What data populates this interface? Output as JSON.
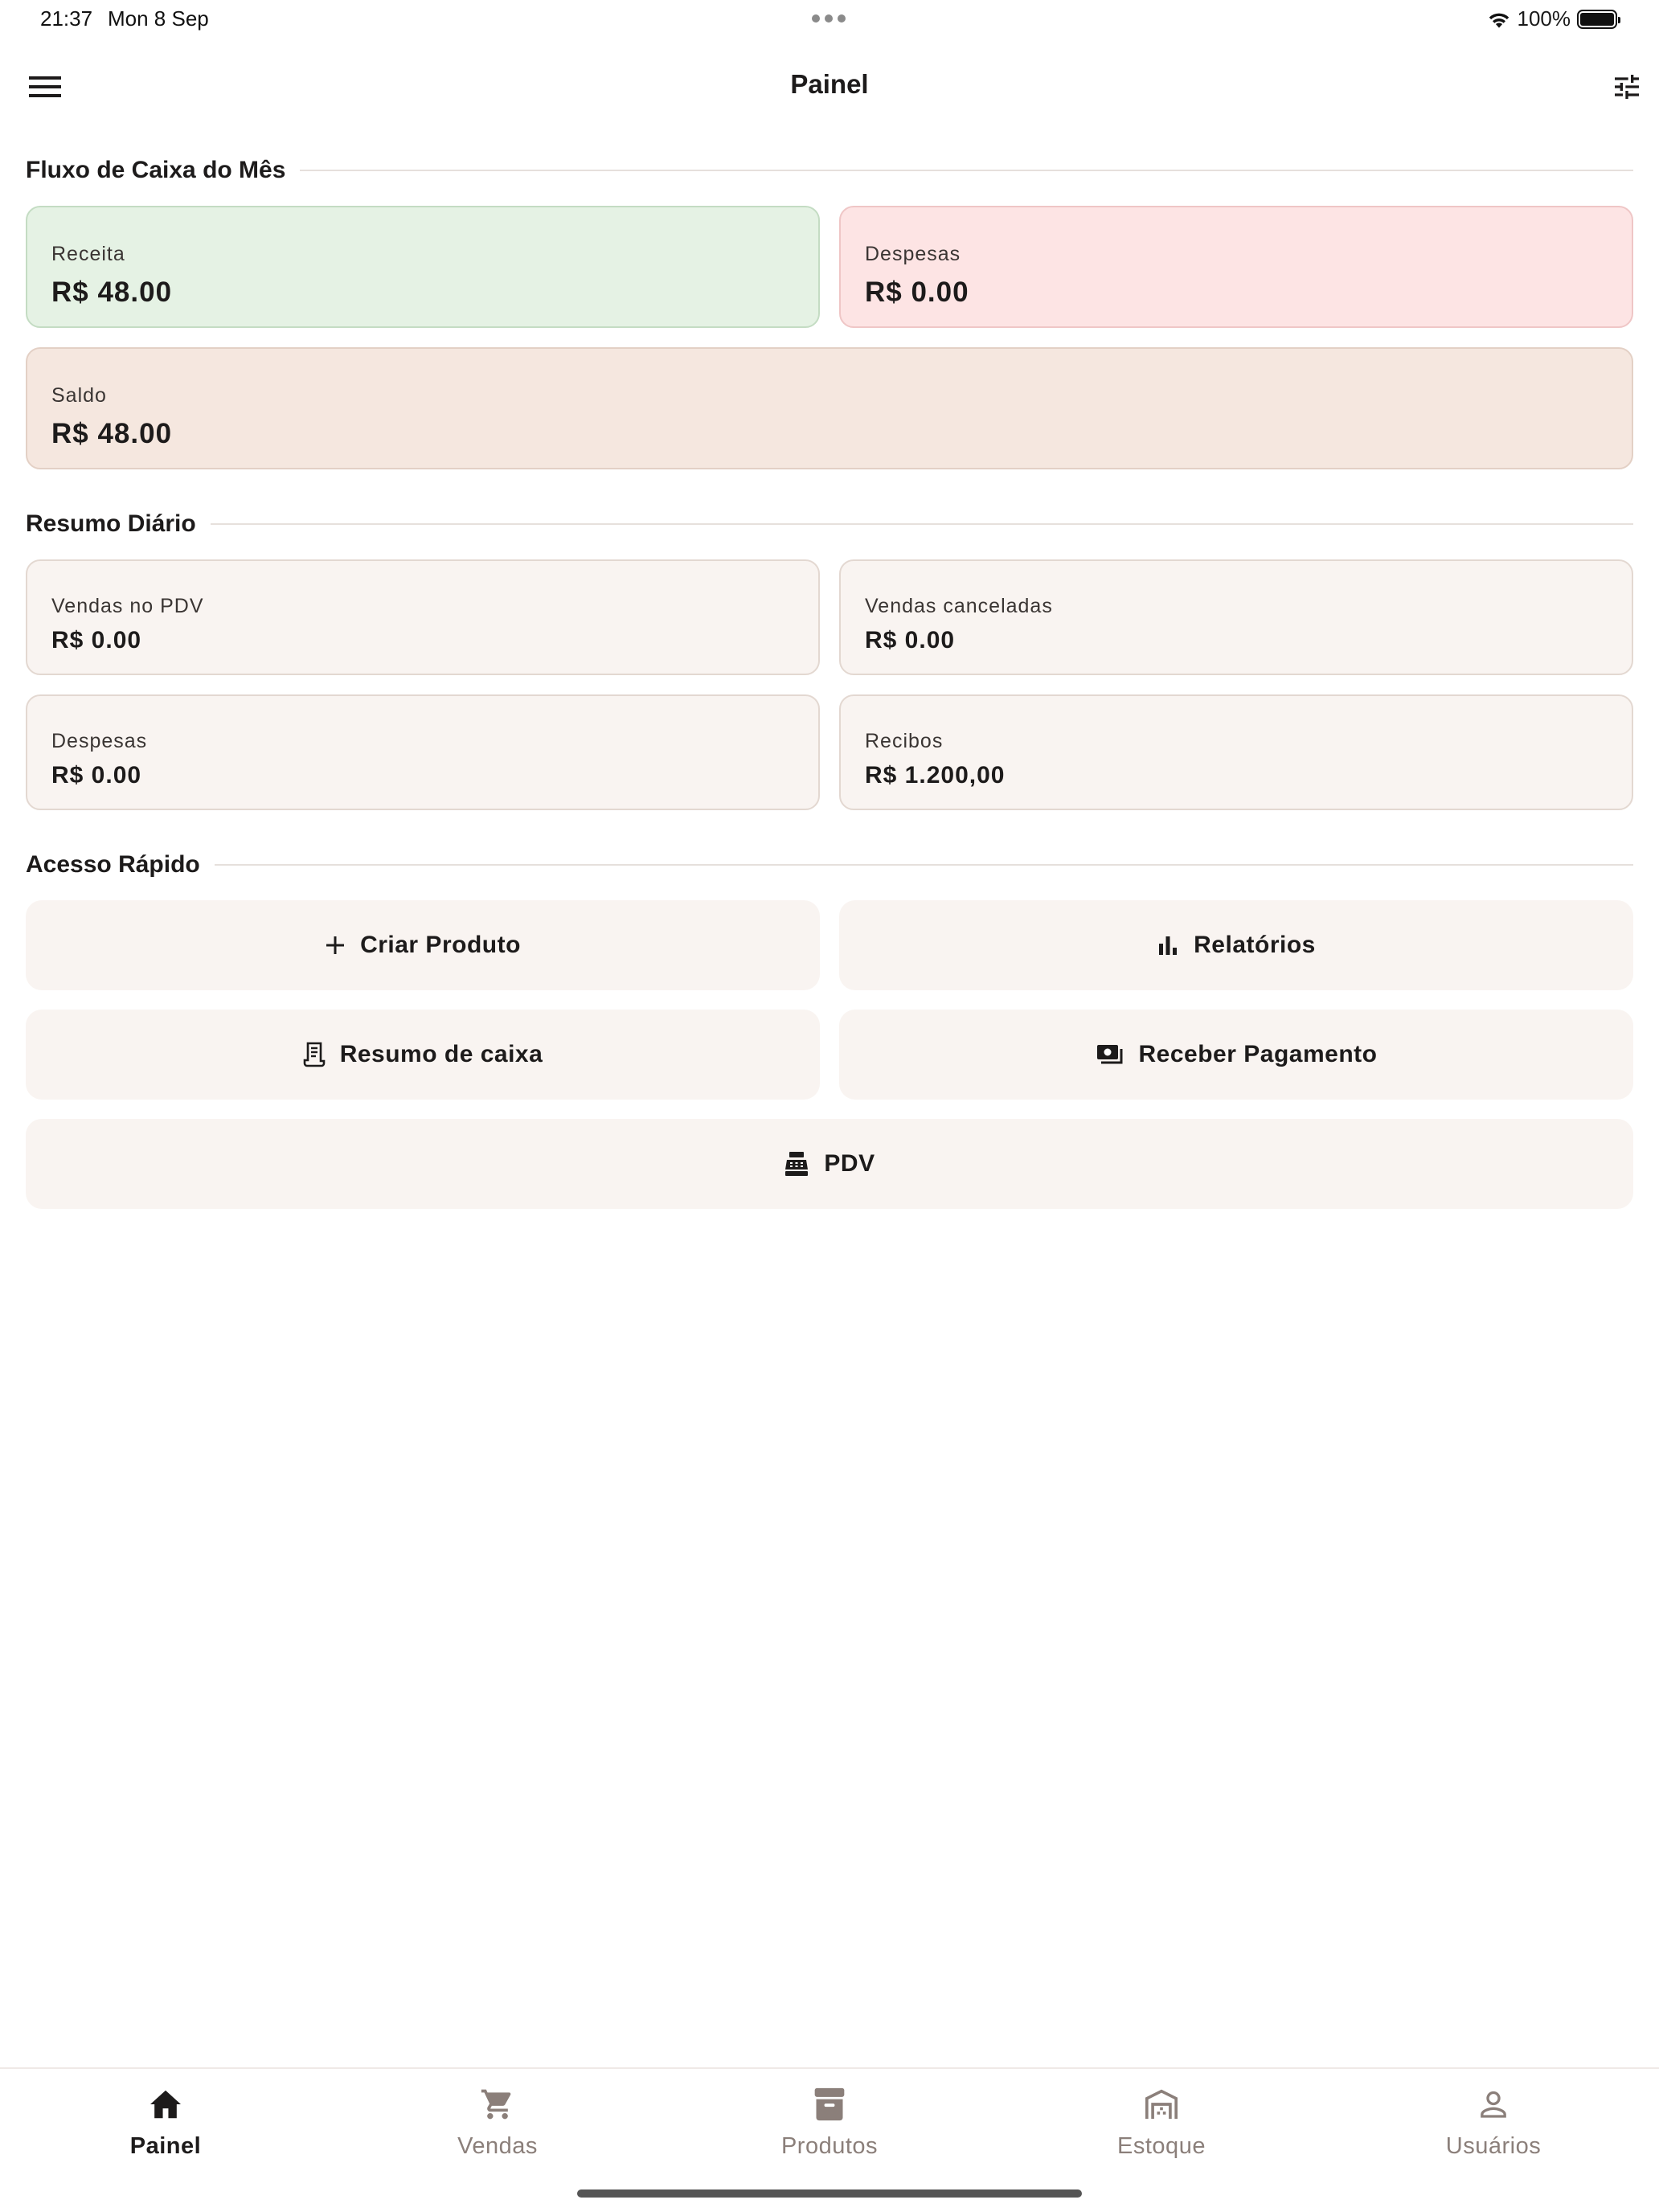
{
  "status_bar": {
    "time": "21:37",
    "date": "Mon 8 Sep",
    "battery": "100%",
    "battery_level": 1.0
  },
  "app_bar": {
    "title": "Painel",
    "menu_icon": "menu-icon",
    "filter_icon": "tune-icon"
  },
  "cash_flow": {
    "title": "Fluxo de Caixa do Mês",
    "receita": {
      "label": "Receita",
      "value": "R$ 48.00",
      "color": "#e5f2e4"
    },
    "despesas": {
      "label": "Despesas",
      "value": "R$ 0.00",
      "color": "#fde4e4"
    },
    "saldo": {
      "label": "Saldo",
      "value": "R$ 48.00",
      "color": "#f5e7df"
    }
  },
  "daily_summary": {
    "title": "Resumo Diário",
    "vendas_pdv": {
      "label": "Vendas no PDV",
      "value": "R$ 0.00"
    },
    "vendas_canceladas": {
      "label": "Vendas canceladas",
      "value": "R$ 0.00"
    },
    "despesas": {
      "label": "Despesas",
      "value": "R$ 0.00"
    },
    "recibos": {
      "label": "Recibos",
      "value": "R$ 1.200,00"
    }
  },
  "quick_access": {
    "title": "Acesso Rápido",
    "criar_produto": {
      "label": "Criar Produto",
      "icon": "plus-icon"
    },
    "relatorios": {
      "label": "Relatórios",
      "icon": "bar-chart-icon"
    },
    "resumo_caixa": {
      "label": "Resumo de caixa",
      "icon": "receipt-icon"
    },
    "receber_pagamento": {
      "label": "Receber Pagamento",
      "icon": "payments-icon"
    },
    "pdv": {
      "label": "PDV",
      "icon": "cash-register-icon"
    }
  },
  "bottom_nav": {
    "items": [
      {
        "label": "Painel",
        "icon": "home-icon",
        "active": true
      },
      {
        "label": "Vendas",
        "icon": "cart-icon",
        "active": false
      },
      {
        "label": "Produtos",
        "icon": "inventory-box-icon",
        "active": false
      },
      {
        "label": "Estoque",
        "icon": "warehouse-icon",
        "active": false
      },
      {
        "label": "Usuários",
        "icon": "person-icon",
        "active": false
      }
    ],
    "active_color": "#1d1b1b",
    "inactive_color": "#8b7f7a"
  }
}
